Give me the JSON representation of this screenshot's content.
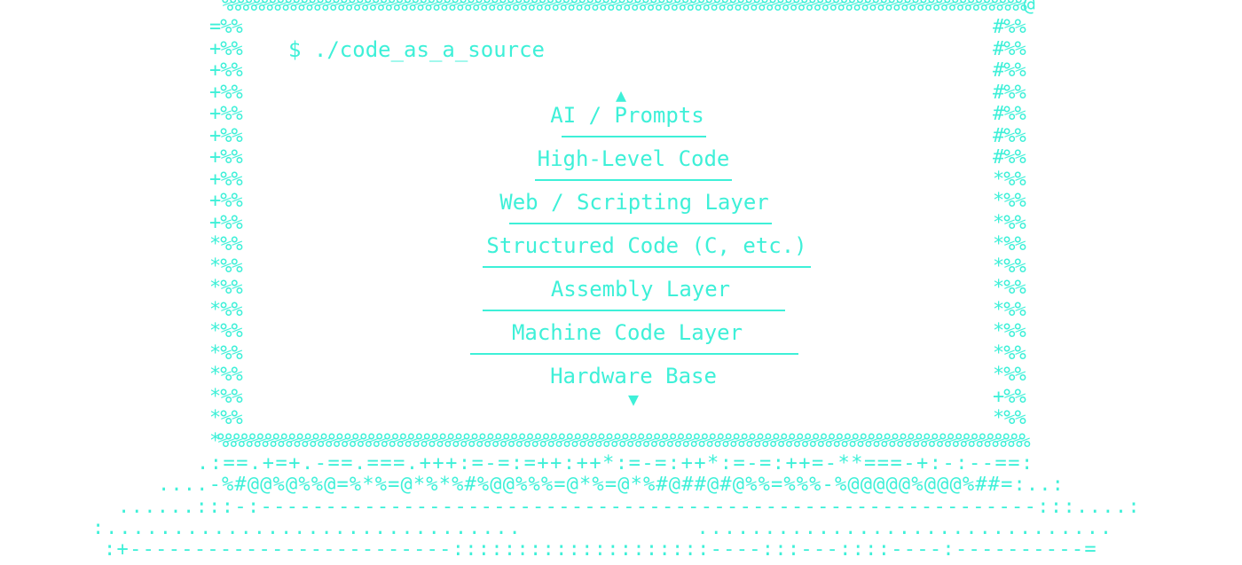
{
  "accent_color": "#3ef0d8",
  "background_color": "#ffffff",
  "frame": {
    "top": "%%%%%%%%%%%%%%%%%%%%%%%%%%%%%%%%%%%%%%%%%%%%%%%%%%%%%%%%%%%%%%%%%%%%%%%%%%%%%%%%%%%%%%%%%%%%%%%%%%%%%@",
    "left": [
      "=%%",
      "+%%",
      "+%%",
      "+%%",
      "+%%",
      "+%%",
      "+%%",
      "+%%",
      "+%%",
      "+%%",
      "*%%",
      "*%%",
      "*%%",
      "*%%",
      "*%%",
      "*%%",
      "*%%",
      "*%%",
      "*%%"
    ],
    "right": [
      "#%%",
      "#%%",
      "#%%",
      "#%%",
      "#%%",
      "#%%",
      "#%%",
      "*%%",
      "*%%",
      "*%%",
      "*%%",
      "*%%",
      "*%%",
      "*%%",
      "*%%",
      "*%%",
      "*%%",
      "+%%",
      "*%%"
    ],
    "bottom": "*%%%%%%%%%%%%%%%%%%%%%%%%%%%%%%%%%%%%%%%%%%%%%%%%%%%%%%%%%%%%%%%%%%%%%%%%%%%%%%%%%%%%%%%%%%%%%%%%%%%%%%"
  },
  "prompt": "$ ./code_as_a_source",
  "arrows": {
    "up": "▲",
    "down": "▼"
  },
  "layers": [
    "AI / Prompts",
    "High-Level Code",
    "Web / Scripting Layer",
    "Structured Code (C, etc.)",
    "Assembly Layer",
    "Machine Code Layer",
    "Hardware Base"
  ],
  "base": [
    ".:==.+=+.-==.===.+++:=-=:=++:++*:=-=:++*:=-=:++=-**===-+:-:--==:",
    "....-%#@@%@%%@=%*%=@*%*%#%@@%%%=@*%=@*%#@##@#@%%=%%%-%@@@@@%@@@%##=:..:",
    "......:::-:------------------------------------------------------------:::....:",
    ":...............................             ...............................",
    ":+-------------------------::::::::::::::::::::----:::---::::----:----------="
  ]
}
